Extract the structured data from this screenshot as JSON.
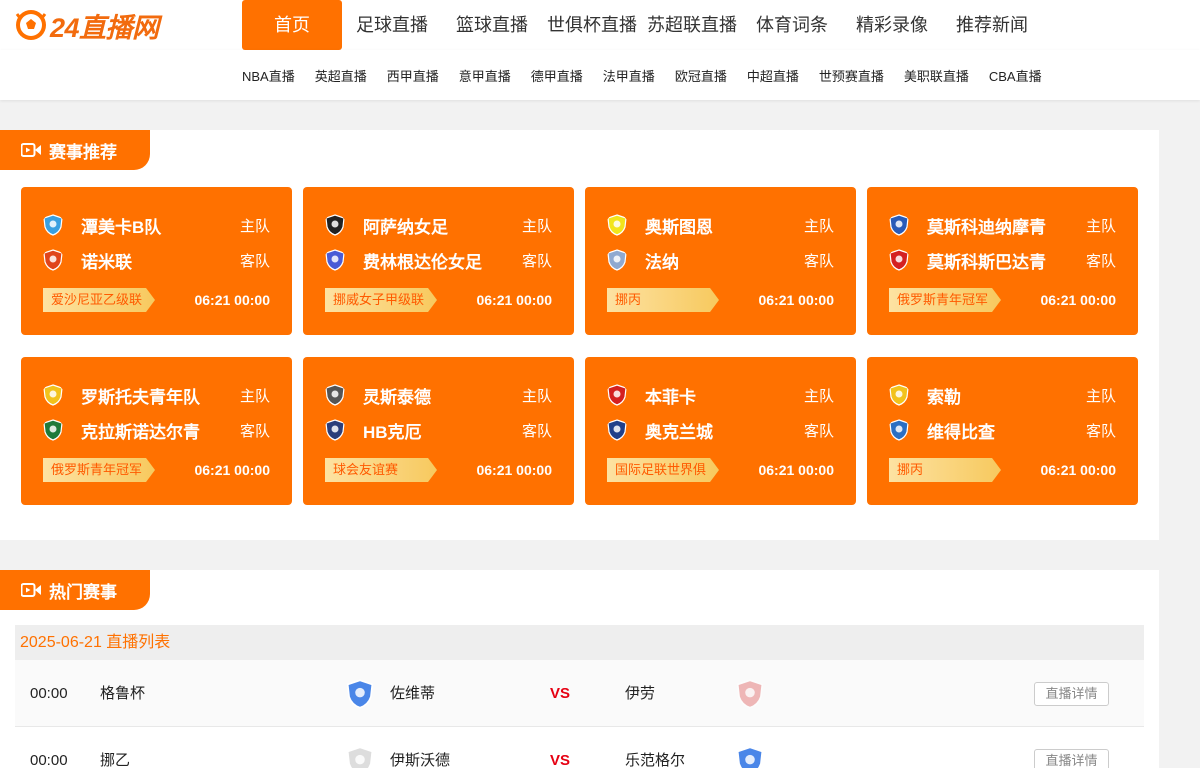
{
  "brand": {
    "logo_text": "24直播网",
    "accent": "#ff7100"
  },
  "nav": {
    "items": [
      {
        "label": "首页",
        "active": true,
        "w": 100
      },
      {
        "label": "足球直播",
        "w": 100
      },
      {
        "label": "篮球直播",
        "w": 100
      },
      {
        "label": "世俱杯直播",
        "w": 100
      },
      {
        "label": "苏超联直播",
        "w": 100
      },
      {
        "label": "体育词条",
        "w": 100
      },
      {
        "label": "精彩录像",
        "w": 100
      },
      {
        "label": "推荐新闻",
        "w": 100
      }
    ]
  },
  "subnav": {
    "items": [
      "NBA直播",
      "英超直播",
      "西甲直播",
      "意甲直播",
      "德甲直播",
      "法甲直播",
      "欧冠直播",
      "中超直播",
      "世预赛直播",
      "美职联直播",
      "CBA直播"
    ]
  },
  "recommend": {
    "title": "赛事推荐",
    "cards": [
      {
        "home": "潭美卡B队",
        "away": "诺米联",
        "home_role": "主队",
        "away_role": "客队",
        "league": "爱沙尼亚乙级联",
        "time": "06:21 00:00",
        "home_icon": "club-crest-icon",
        "away_icon": "club-crest-icon",
        "hc": "#3aa0e0",
        "ac": "#e0451b"
      },
      {
        "home": "阿萨纳女足",
        "away": "费林根达伦女足",
        "home_role": "主队",
        "away_role": "客队",
        "league": "挪威女子甲级联",
        "time": "06:21 00:00",
        "home_icon": "club-crest-icon",
        "away_icon": "club-crest-icon",
        "hc": "#222222",
        "ac": "#4a5bd6"
      },
      {
        "home": "奥斯图恩",
        "away": "法纳",
        "home_role": "主队",
        "away_role": "客队",
        "league": "挪丙",
        "time": "06:21 00:00",
        "home_icon": "club-crest-icon",
        "away_icon": "club-crest-icon",
        "hc": "#f2e51b",
        "ac": "#8fa9d0"
      },
      {
        "home": "莫斯科迪纳摩青",
        "away": "莫斯科斯巴达青",
        "home_role": "主队",
        "away_role": "客队",
        "league": "俄罗斯青年冠军",
        "time": "06:21 00:00",
        "home_icon": "club-crest-icon",
        "away_icon": "club-crest-icon",
        "hc": "#2a5bb8",
        "ac": "#d42020"
      },
      {
        "home": "罗斯托夫青年队",
        "away": "克拉斯诺达尔青",
        "home_role": "主队",
        "away_role": "客队",
        "league": "俄罗斯青年冠军",
        "time": "06:21 00:00",
        "home_icon": "club-crest-icon",
        "away_icon": "club-crest-icon",
        "hc": "#f2c21b",
        "ac": "#1f7a3a"
      },
      {
        "home": "灵斯泰德",
        "away": "HB克厄",
        "home_role": "主队",
        "away_role": "客队",
        "league": "球会友谊赛",
        "time": "06:21 00:00",
        "home_icon": "club-crest-icon",
        "away_icon": "club-crest-icon",
        "hc": "#555555",
        "ac": "#2b3e7a"
      },
      {
        "home": "本菲卡",
        "away": "奥克兰城",
        "home_role": "主队",
        "away_role": "客队",
        "league": "国际足联世界俱",
        "time": "06:21 00:00",
        "home_icon": "club-crest-icon",
        "away_icon": "club-crest-icon",
        "hc": "#d42020",
        "ac": "#1f3f8a"
      },
      {
        "home": "索勒",
        "away": "维得比查",
        "home_role": "主队",
        "away_role": "客队",
        "league": "挪丙",
        "time": "06:21 00:00",
        "home_icon": "club-crest-icon",
        "away_icon": "club-crest-icon",
        "hc": "#f2c21b",
        "ac": "#2b6fc2"
      }
    ]
  },
  "hot": {
    "title": "热门赛事",
    "date_label": "2025-06-21 直播列表",
    "rows": [
      {
        "time": "00:00",
        "league": "格鲁杯",
        "home": "佐维蒂",
        "vs": "VS",
        "away": "伊劳",
        "button": "直播详情"
      },
      {
        "time": "00:00",
        "league": "挪乙",
        "home": "伊斯沃德",
        "vs": "VS",
        "away": "乐范格尔",
        "button": "直播详情"
      }
    ]
  }
}
